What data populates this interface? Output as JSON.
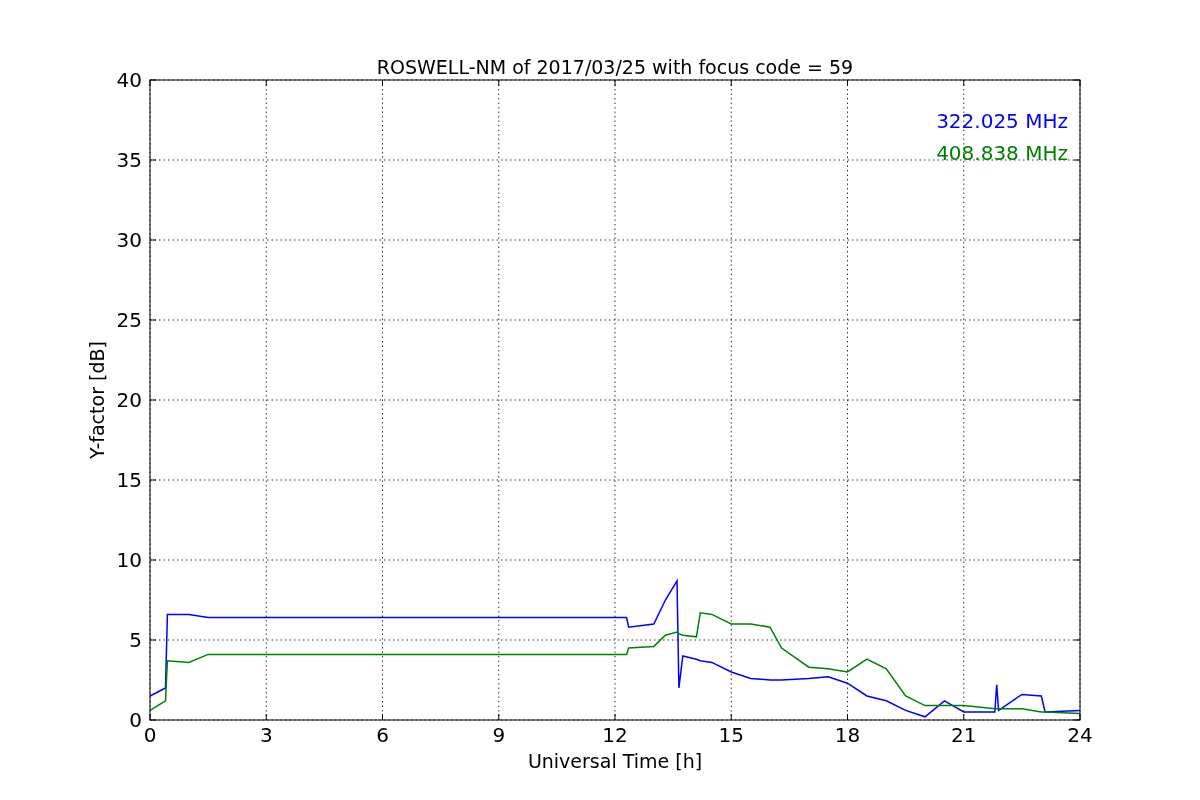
{
  "chart_data": {
    "type": "line",
    "title": "ROSWELL-NM of 2017/03/25 with focus code = 59",
    "xlabel": "Universal Time [h]",
    "ylabel": "Y-factor [dB]",
    "x": [
      0,
      0.4,
      0.45,
      1,
      1.5,
      12.3,
      12.35,
      13,
      13.3,
      13.6,
      13.65,
      13.75,
      14.1,
      14.2,
      14.5,
      15,
      15.5,
      16,
      16.3,
      17,
      17.5,
      18,
      18.5,
      19,
      19.5,
      20,
      20.5,
      21,
      21.8,
      21.85,
      21.9,
      22.5,
      23,
      23.1,
      24
    ],
    "series": [
      {
        "name": "322.025 MHz",
        "color": "#0000ff",
        "values": [
          1.5,
          2.0,
          6.6,
          6.6,
          6.4,
          6.4,
          5.8,
          6.0,
          7.5,
          8.7,
          2.0,
          4.0,
          3.8,
          3.7,
          3.6,
          3.0,
          2.6,
          2.5,
          2.5,
          2.6,
          2.7,
          2.3,
          1.5,
          1.2,
          0.6,
          0.2,
          1.2,
          0.5,
          0.5,
          2.2,
          0.6,
          1.6,
          1.5,
          0.5,
          0.6
        ]
      },
      {
        "name": "408.838 MHz",
        "color": "#008000",
        "values": [
          0.6,
          1.2,
          3.7,
          3.6,
          4.1,
          4.1,
          4.5,
          4.6,
          5.3,
          5.5,
          5.4,
          5.3,
          5.2,
          6.7,
          6.6,
          6.0,
          6.0,
          5.8,
          4.5,
          3.3,
          3.2,
          3.0,
          3.8,
          3.2,
          1.5,
          0.9,
          0.9,
          0.9,
          0.7,
          0.7,
          0.7,
          0.7,
          0.5,
          0.5,
          0.4
        ]
      }
    ],
    "xlim": [
      0,
      24
    ],
    "ylim": [
      0,
      40
    ],
    "xticks": [
      0,
      3,
      6,
      9,
      12,
      15,
      18,
      21,
      24
    ],
    "yticks": [
      0,
      5,
      10,
      15,
      20,
      25,
      30,
      35,
      40
    ],
    "grid": true
  }
}
